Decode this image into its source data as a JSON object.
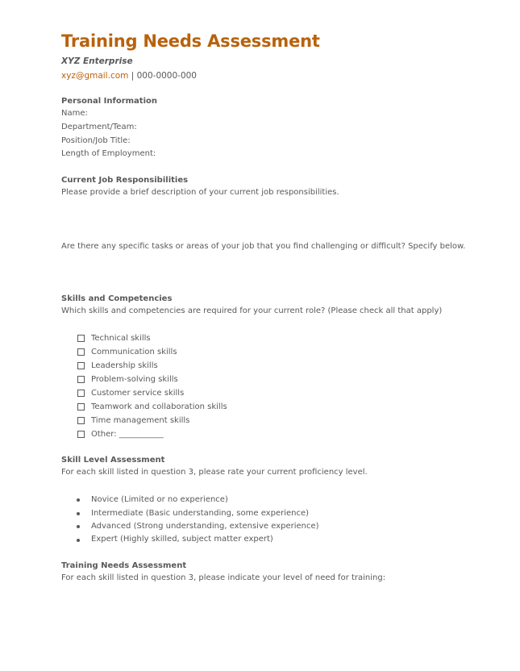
{
  "header": {
    "title": "Training Needs Assessment",
    "company": "XYZ Enterprise",
    "email": "xyz@gmail.com",
    "separator": "|",
    "phone": "000-0000-000"
  },
  "personal_info": {
    "heading": "Personal Information",
    "fields": [
      "Name:",
      "Department/Team:",
      "Position/Job Title:",
      "Length of Employment:"
    ]
  },
  "responsibilities": {
    "heading": "Current Job Responsibilities",
    "prompt": "Please provide a brief description of your current job responsibilities.",
    "challenge_prompt": "Are there any specific tasks or areas of your job that you find challenging or difficult? Specify below."
  },
  "skills": {
    "heading": "Skills and Competencies",
    "prompt": "Which skills and competencies are required for your current role? (Please check all that apply)",
    "options": [
      "Technical skills",
      "Communication skills",
      "Leadership skills",
      "Problem-solving skills",
      "Customer service skills",
      "Teamwork and collaboration skills",
      "Time management skills",
      "Other: ___________"
    ]
  },
  "skill_level": {
    "heading": "Skill Level Assessment",
    "prompt": "For each skill listed in question 3, please rate your current proficiency level.",
    "levels": [
      "Novice (Limited or no experience)",
      "Intermediate (Basic understanding, some experience)",
      "Advanced (Strong understanding, extensive experience)",
      "Expert (Highly skilled, subject matter expert)"
    ]
  },
  "training_needs": {
    "heading": "Training Needs Assessment",
    "prompt": "For each skill listed in question 3, please indicate your level of need for training:"
  },
  "colors": {
    "accent": "#b8620d",
    "body_text": "#595959"
  }
}
